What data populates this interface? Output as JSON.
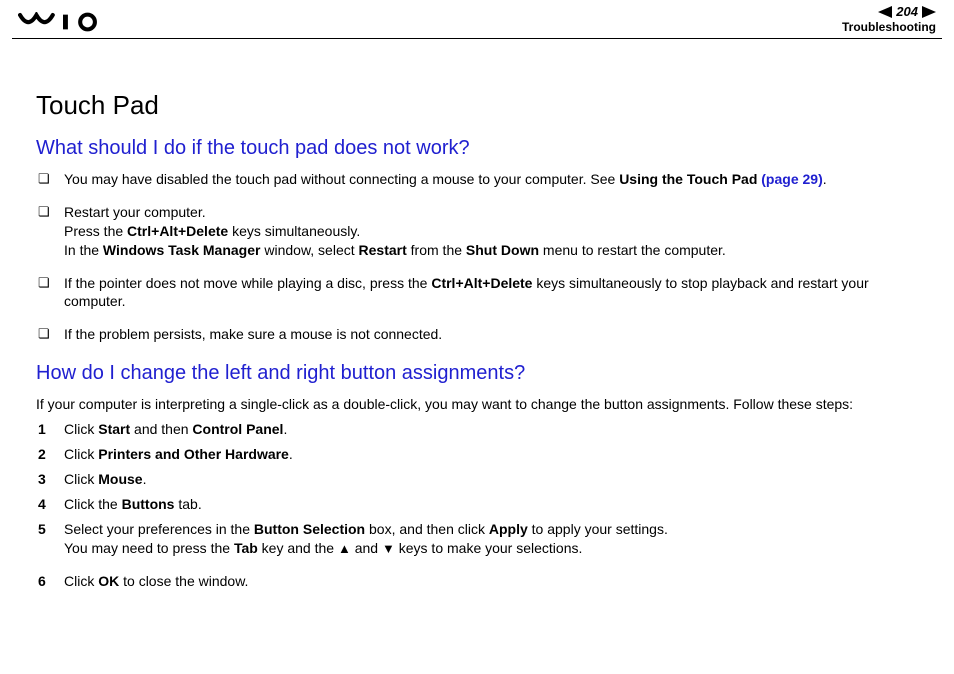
{
  "header": {
    "page_number": "204",
    "section": "Troubleshooting"
  },
  "title": "Touch Pad",
  "q1": {
    "heading": "What should I do if the touch pad does not work?",
    "items": [
      {
        "pre": "You may have disabled the touch pad without connecting a mouse to your computer. See ",
        "bold1": "Using the Touch Pad ",
        "link": "(page 29)",
        "post": "."
      },
      {
        "line1_a": "Restart your computer.",
        "line2_a": "Press the ",
        "line2_b": "Ctrl+Alt+Delete",
        "line2_c": " keys simultaneously.",
        "line3_a": "In the ",
        "line3_b": "Windows Task Manager",
        "line3_c": " window, select ",
        "line3_d": "Restart",
        "line3_e": " from the ",
        "line3_f": "Shut Down",
        "line3_g": " menu to restart the computer."
      },
      {
        "a": "If the pointer does not move while playing a disc, press the ",
        "b": "Ctrl+Alt+Delete",
        "c": " keys simultaneously to stop playback and restart your computer."
      },
      {
        "text": "If the problem persists, make sure a mouse is not connected."
      }
    ]
  },
  "q2": {
    "heading": "How do I change the left and right button assignments?",
    "intro": "If your computer is interpreting a single-click as a double-click, you may want to change the button assignments. Follow these steps:",
    "steps": [
      {
        "n": "1",
        "a": "Click ",
        "b": "Start",
        "c": " and then ",
        "d": "Control Panel",
        "e": "."
      },
      {
        "n": "2",
        "a": "Click ",
        "b": "Printers and Other Hardware",
        "c": "."
      },
      {
        "n": "3",
        "a": "Click ",
        "b": "Mouse",
        "c": "."
      },
      {
        "n": "4",
        "a": "Click the ",
        "b": "Buttons",
        "c": " tab."
      },
      {
        "n": "5",
        "l1a": "Select your preferences in the ",
        "l1b": "Button Selection",
        "l1c": " box, and then click ",
        "l1d": "Apply",
        "l1e": " to apply your settings.",
        "l2a": "You may need to press the ",
        "l2b": "Tab",
        "l2c": " key and the ",
        "l2d_icon": "up-arrow",
        "l2e": " and ",
        "l2f_icon": "down-arrow",
        "l2g": " keys to make your selections."
      },
      {
        "n": "6",
        "a": "Click ",
        "b": "OK",
        "c": " to close the window."
      }
    ]
  }
}
